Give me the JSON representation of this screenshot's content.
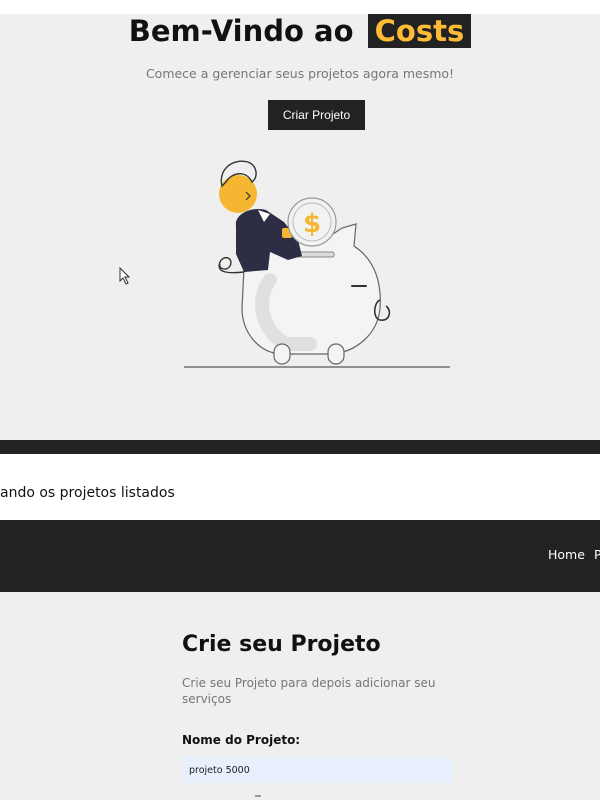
{
  "hero": {
    "title_prefix": "Bem-Vindo ao",
    "title_highlight": "Costs",
    "subtitle": "Comece a gerenciar seus projetos agora mesmo!",
    "button_label": "Criar Projeto",
    "dollar_sign": "$"
  },
  "caption": "ando os projetos listados",
  "navbar": {
    "home_label": "Home",
    "next_label_partial": "P"
  },
  "form": {
    "title": "Crie seu Projeto",
    "subtitle": "Crie seu Projeto para depois adicionar seu serviços",
    "name_label": "Nome do Projeto:",
    "name_value": "projeto 5000"
  },
  "colors": {
    "dark": "#222222",
    "accent": "#ffbb33",
    "background": "#efefef",
    "input_bg": "#e8f0fe"
  }
}
